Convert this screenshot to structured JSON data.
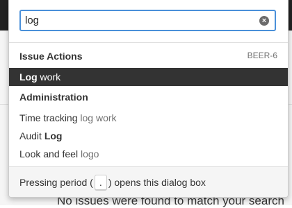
{
  "background": {
    "message": "No issues were found to match your search"
  },
  "search": {
    "value": "log",
    "clear_label": "×"
  },
  "issue_actions": {
    "title": "Issue Actions",
    "issue_key": "BEER-6",
    "items": [
      {
        "match": "Log",
        "rest": " work"
      }
    ]
  },
  "administration": {
    "title": "Administration",
    "items": [
      {
        "text": "Time tracking ",
        "match": "log work"
      },
      {
        "text": "Audit ",
        "match": "Log"
      },
      {
        "text": "Look and feel ",
        "match": "logo"
      }
    ]
  },
  "footer": {
    "prefix": "Pressing period (",
    "key": ".",
    "suffix": ") opens this dialog box"
  },
  "colors": {
    "selected_bg": "#333333",
    "focus_border": "#4a90d9"
  }
}
